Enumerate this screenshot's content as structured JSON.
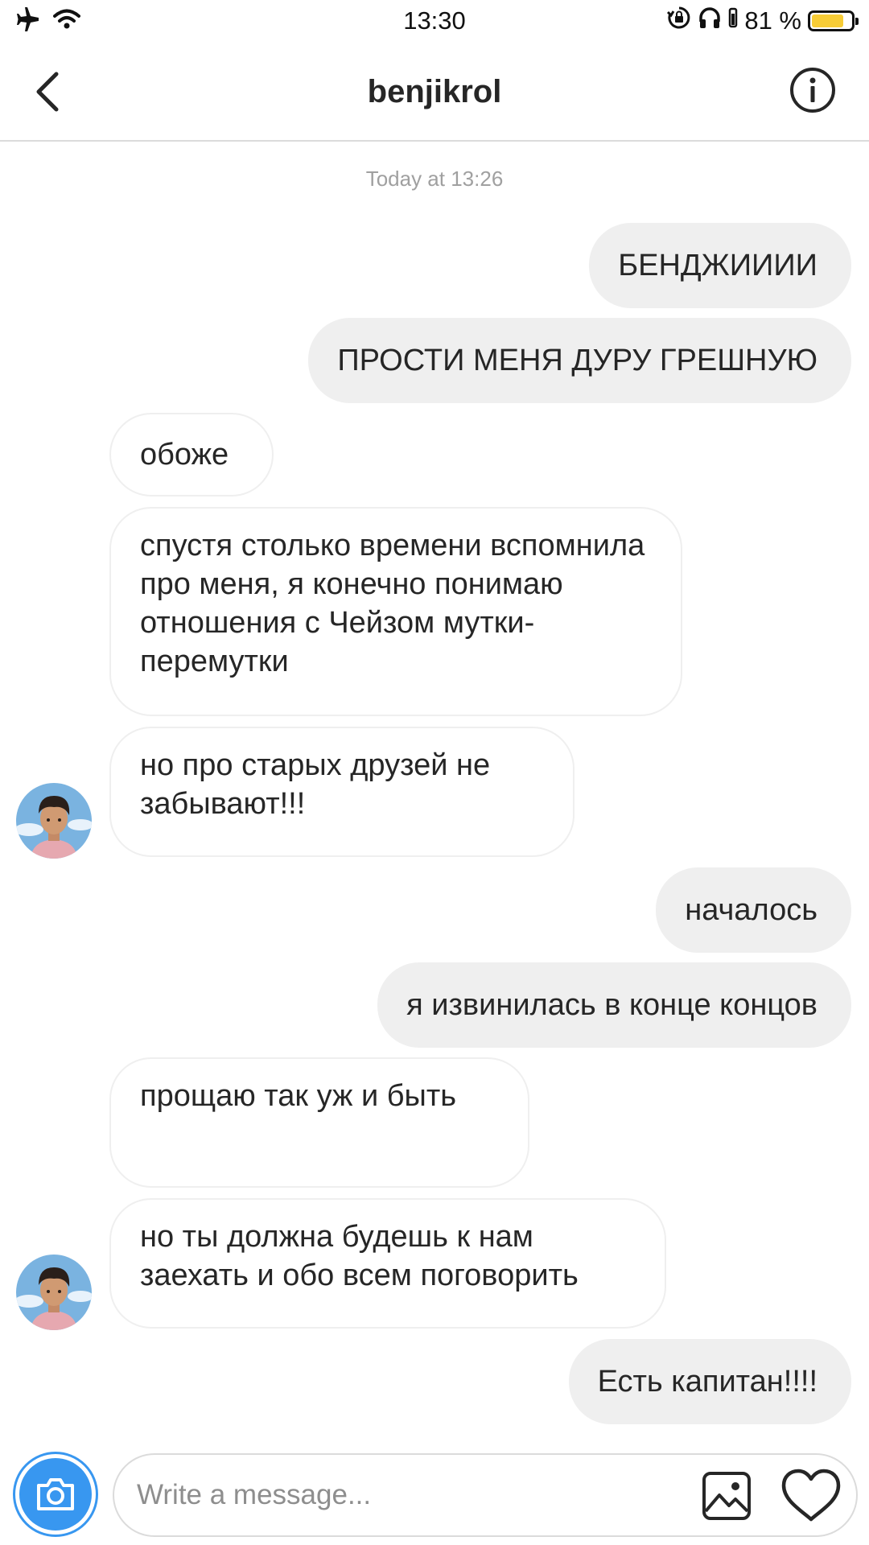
{
  "status_bar": {
    "time": "13:30",
    "battery_percent": "81 %",
    "battery_level": 0.81,
    "icons": [
      "airplane-icon",
      "wifi-icon",
      "orientation-lock-icon",
      "headphones-icon",
      "battery-icon"
    ]
  },
  "header": {
    "title": "benjikrol",
    "back_icon": "chevron-left-icon",
    "info_icon": "info-icon"
  },
  "thread": {
    "timestamp": "Today at 13:26",
    "messages": [
      {
        "from": "me",
        "text": "БЕНДЖИИИИ"
      },
      {
        "from": "me",
        "text": "ПРОСТИ МЕНЯ ДУРУ ГРЕШНУЮ"
      },
      {
        "from": "them",
        "text": "обоже"
      },
      {
        "from": "them",
        "text": "спустя столько времени вспомнила про меня, я конечно понимаю отношения с Чейзом мутки-перемутки"
      },
      {
        "from": "them",
        "text": "но про старых друзей не забывают!!!"
      },
      {
        "from": "me",
        "text": "началось"
      },
      {
        "from": "me",
        "text": "я извинилась в конце концов"
      },
      {
        "from": "them",
        "text": "прощаю так уж и быть"
      },
      {
        "from": "them",
        "text": "но ты должна будешь к нам заехать и обо всем поговорить"
      },
      {
        "from": "me",
        "text": "Есть капитан!!!!"
      }
    ]
  },
  "composer": {
    "placeholder": "Write a message...",
    "value": "",
    "camera_icon": "camera-icon",
    "gallery_icon": "image-icon",
    "like_icon": "heart-icon"
  },
  "colors": {
    "accent": "#3897f0",
    "outgoing_bubble": "#efefef",
    "incoming_border": "#efefef",
    "battery_fill": "#f7cc36"
  }
}
